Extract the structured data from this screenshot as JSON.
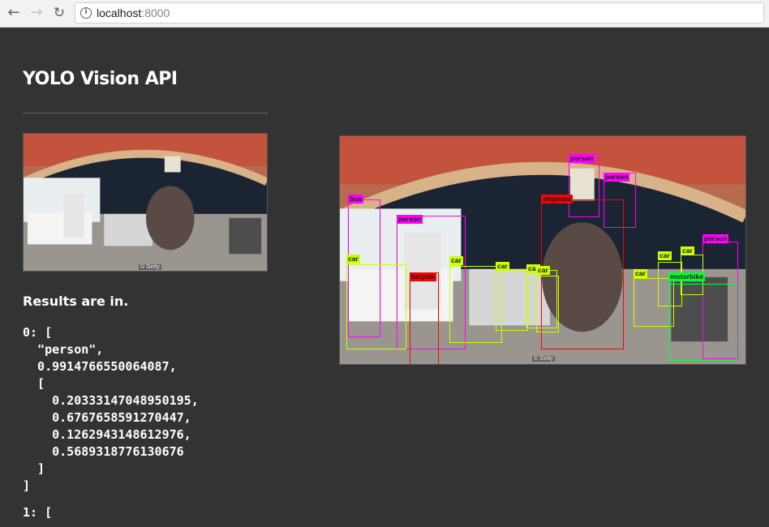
{
  "browser": {
    "url_host": "localhost",
    "url_port": ":8000",
    "back_glyph": "←",
    "forward_glyph": "→",
    "reload_glyph": "↻",
    "info_glyph": "i"
  },
  "page": {
    "title": "YOLO Vision API",
    "results_heading": "Results are in.",
    "image_credit": "© Getty"
  },
  "results_json": [
    "0: [",
    "  \"person\",",
    "  0.9914766550064087,",
    "  [",
    "    0.20333147048950195,",
    "    0.6767658591270447,",
    "    0.1262943148612976,",
    "    0.5689318776130676",
    "  ]",
    "]",
    "",
    "1: ["
  ],
  "detections": [
    {
      "label": "person",
      "color": "#ff00ff"
    },
    {
      "label": "person",
      "color": "#ff00ff"
    },
    {
      "label": "person",
      "color": "#ff00ff"
    },
    {
      "label": "person",
      "color": "#ff00ff"
    },
    {
      "label": "bus",
      "color": "#ff00ff"
    },
    {
      "label": "elephant",
      "color": "#ff0000"
    },
    {
      "label": "bicycle",
      "color": "#ff0000"
    },
    {
      "label": "car",
      "color": "#ccff00"
    },
    {
      "label": "car",
      "color": "#ccff00"
    },
    {
      "label": "car",
      "color": "#ccff00"
    },
    {
      "label": "car",
      "color": "#ccff00"
    },
    {
      "label": "car",
      "color": "#ccff00"
    },
    {
      "label": "car",
      "color": "#ccff00"
    },
    {
      "label": "car",
      "color": "#ccff00"
    },
    {
      "label": "car",
      "color": "#ccff00"
    },
    {
      "label": "motorbike",
      "color": "#00ff33"
    }
  ]
}
